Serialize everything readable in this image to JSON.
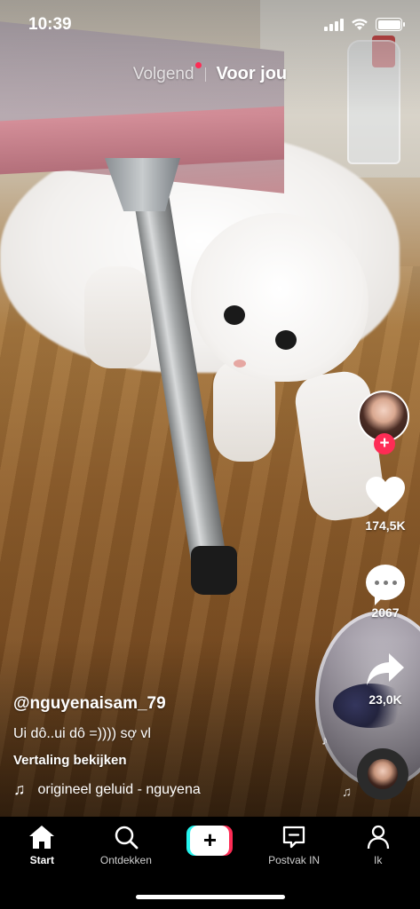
{
  "status_bar": {
    "time": "10:39",
    "wifi_icon": "wifi-icon",
    "battery_icon": "battery-icon",
    "signal_icon": "cellular-signal-icon"
  },
  "top_tabs": {
    "following": "Volgend",
    "for_you": "Voor jou",
    "active": "Voor jou",
    "notification_dot_color": "#fe2c55"
  },
  "actions": {
    "likes": "174,5K",
    "comments": "2067",
    "shares": "23,0K",
    "follow_icon": "plus-icon"
  },
  "caption": {
    "username": "@nguyenaisam_79",
    "description": "Ui dô..ui dô =)))) sợ vl",
    "translate": "Vertaling bekijken",
    "sound": "origineel geluid - nguyena"
  },
  "bottom_nav": {
    "items": [
      {
        "label": "Start",
        "icon": "home-icon",
        "active": true
      },
      {
        "label": "Ontdekken",
        "icon": "search-icon",
        "active": false
      },
      {
        "label": "",
        "icon": "create-plus-icon",
        "active": false
      },
      {
        "label": "Postvak IN",
        "icon": "inbox-icon",
        "active": false
      },
      {
        "label": "Ik",
        "icon": "profile-icon",
        "active": false
      }
    ]
  },
  "colors": {
    "accent": "#fe2c55",
    "cyan": "#25f4ee",
    "nav_bg": "#000000"
  }
}
